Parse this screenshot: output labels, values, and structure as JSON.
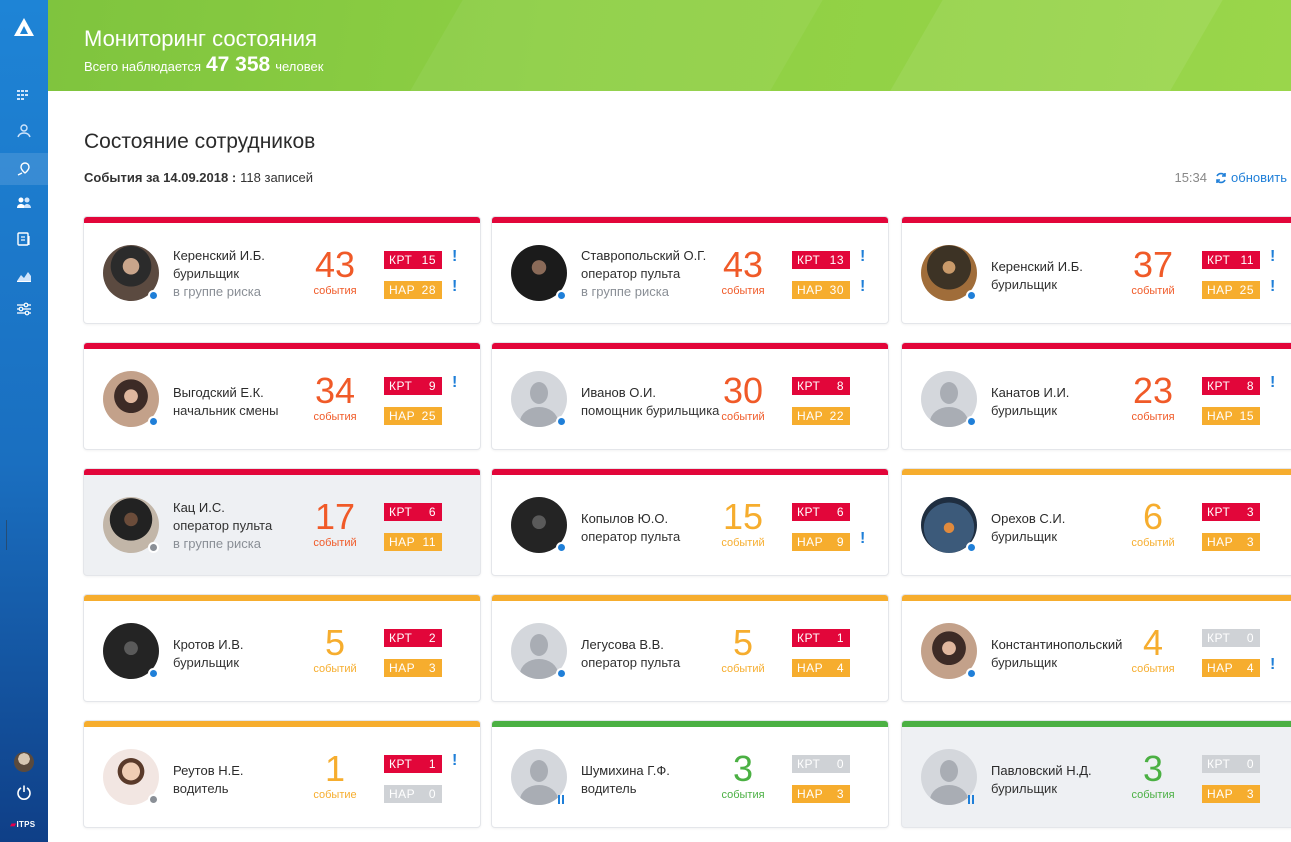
{
  "header": {
    "title": "Мониторинг состояния",
    "subtitle_prefix": "Всего наблюдается",
    "observed_count": "47 358",
    "subtitle_suffix": "человек",
    "accent_color": "#8dcf43"
  },
  "sidebar": {
    "items": [
      {
        "icon": "grid-dashboard-icon"
      },
      {
        "icon": "person-location-icon"
      },
      {
        "icon": "map-pin-icon",
        "active": true
      },
      {
        "icon": "users-icon"
      },
      {
        "icon": "document-icon"
      },
      {
        "icon": "chart-area-icon"
      },
      {
        "icon": "sliders-icon"
      }
    ],
    "power_icon": "power-icon",
    "brand": "ITPS"
  },
  "page": {
    "title": "Состояние сотрудников",
    "events_label": "События за 14.09.2018 :",
    "records": "118 записей",
    "time": "15:34",
    "refresh_label": "обновить"
  },
  "colors": {
    "kpt": "#e2063a",
    "nar": "#f6ad2e",
    "zero": "#cfd2d6",
    "severity_red": "#e2063a",
    "severity_orange": "#f6ad2e",
    "severity_green": "#4bb043",
    "status_blue": "#1f7fd8",
    "status_gray": "#8a8f96"
  },
  "cards": [
    {
      "name": "Керенский И.Б.",
      "role": "бурильщик",
      "risk": "в группе риска",
      "events": "43",
      "events_unit": "события",
      "kpt_label": "КРТ",
      "kpt": "15",
      "nar_label": "НАР",
      "nar": "28",
      "kpt_alert": "!",
      "nar_alert": "!"
    },
    {
      "name": "Ставропольский О.Г.",
      "role": "оператор пульта",
      "risk": "в группе риска",
      "events": "43",
      "events_unit": "события",
      "kpt_label": "КРТ",
      "kpt": "13",
      "nar_label": "НАР",
      "nar": "30",
      "kpt_alert": "!",
      "nar_alert": "!"
    },
    {
      "name": "Керенский И.Б.",
      "role": "бурильщик",
      "risk": "",
      "events": "37",
      "events_unit": "событий",
      "kpt_label": "КРТ",
      "kpt": "11",
      "nar_label": "НАР",
      "nar": "25",
      "kpt_alert": "!",
      "nar_alert": "!"
    },
    {
      "name": "Выгодский Е.К.",
      "role": "начальник смены",
      "risk": "",
      "events": "34",
      "events_unit": "события",
      "kpt_label": "КРТ",
      "kpt": "9",
      "nar_label": "НАР",
      "nar": "25",
      "kpt_alert": "!",
      "nar_alert": ""
    },
    {
      "name": "Иванов О.И.",
      "role": "помощник бурильщика",
      "risk": "",
      "events": "30",
      "events_unit": "событий",
      "kpt_label": "КРТ",
      "kpt": "8",
      "nar_label": "НАР",
      "nar": "22",
      "kpt_alert": "",
      "nar_alert": ""
    },
    {
      "name": "Канатов И.И.",
      "role": "бурильщик",
      "risk": "",
      "events": "23",
      "events_unit": "события",
      "kpt_label": "КРТ",
      "kpt": "8",
      "nar_label": "НАР",
      "nar": "15",
      "kpt_alert": "!",
      "nar_alert": ""
    },
    {
      "name": "Кац И.С.",
      "role": "оператор пульта",
      "risk": "в группе риска",
      "events": "17",
      "events_unit": "событий",
      "kpt_label": "КРТ",
      "kpt": "6",
      "nar_label": "НАР",
      "nar": "11",
      "kpt_alert": "",
      "nar_alert": ""
    },
    {
      "name": "Копылов Ю.О.",
      "role": "оператор пульта",
      "risk": "",
      "events": "15",
      "events_unit": "событий",
      "kpt_label": "КРТ",
      "kpt": "6",
      "nar_label": "НАР",
      "nar": "9",
      "kpt_alert": "",
      "nar_alert": "!"
    },
    {
      "name": "Орехов С.И.",
      "role": "бурильщик",
      "risk": "",
      "events": "6",
      "events_unit": "событий",
      "kpt_label": "КРТ",
      "kpt": "3",
      "nar_label": "НАР",
      "nar": "3",
      "kpt_alert": "",
      "nar_alert": ""
    },
    {
      "name": "Кротов И.В.",
      "role": "бурильщик",
      "risk": "",
      "events": "5",
      "events_unit": "событий",
      "kpt_label": "КРТ",
      "kpt": "2",
      "nar_label": "НАР",
      "nar": "3",
      "kpt_alert": "",
      "nar_alert": ""
    },
    {
      "name": "Легусова В.В.",
      "role": "оператор пульта",
      "risk": "",
      "events": "5",
      "events_unit": "событий",
      "kpt_label": "КРТ",
      "kpt": "1",
      "nar_label": "НАР",
      "nar": "4",
      "kpt_alert": "",
      "nar_alert": ""
    },
    {
      "name": "Константинопольский",
      "role": "бурильщик",
      "risk": "",
      "events": "4",
      "events_unit": "события",
      "kpt_label": "КРТ",
      "kpt": "0",
      "nar_label": "НАР",
      "nar": "4",
      "kpt_alert": "",
      "nar_alert": "!"
    },
    {
      "name": "Реутов Н.Е.",
      "role": "водитель",
      "risk": "",
      "events": "1",
      "events_unit": "событие",
      "kpt_label": "КРТ",
      "kpt": "1",
      "nar_label": "НАР",
      "nar": "0",
      "kpt_alert": "!",
      "nar_alert": ""
    },
    {
      "name": "Шумихина Г.Ф.",
      "role": "водитель",
      "risk": "",
      "events": "3",
      "events_unit": "события",
      "kpt_label": "КРТ",
      "kpt": "0",
      "nar_label": "НАР",
      "nar": "3",
      "kpt_alert": "",
      "nar_alert": ""
    },
    {
      "name": "Павловский Н.Д.",
      "role": "бурильщик",
      "risk": "",
      "events": "3",
      "events_unit": "события",
      "kpt_label": "КРТ",
      "kpt": "0",
      "nar_label": "НАР",
      "nar": "3",
      "kpt_alert": "",
      "nar_alert": ""
    }
  ]
}
